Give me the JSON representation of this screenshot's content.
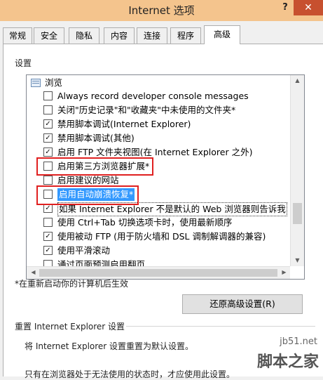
{
  "window": {
    "title": "Internet 选项",
    "help_label": "?",
    "close_label": "✕"
  },
  "tabs": [
    {
      "label": "常规"
    },
    {
      "label": "安全"
    },
    {
      "label": "隐私"
    },
    {
      "label": "内容"
    },
    {
      "label": "连接"
    },
    {
      "label": "程序"
    },
    {
      "label": "高级",
      "active": true
    }
  ],
  "settings": {
    "group_label": "设置",
    "category": "浏览",
    "items": [
      {
        "label": "Always record developer console messages",
        "checked": false
      },
      {
        "label": "关闭\"历史记录\"和\"收藏夹\"中未使用的文件夹*",
        "checked": false
      },
      {
        "label": "禁用脚本调试(Internet Explorer)",
        "checked": true
      },
      {
        "label": "禁用脚本调试(其他)",
        "checked": true
      },
      {
        "label": "启用 FTP 文件夹视图(在 Internet Explorer 之外)",
        "checked": true
      },
      {
        "label": "启用第三方浏览器扩展*",
        "checked": false
      },
      {
        "label": "启用建议的网站",
        "checked": false
      },
      {
        "label": "启用自动崩溃恢复*",
        "checked": false
      },
      {
        "label": "如果 Internet Explorer 不是默认的 Web 浏览器则告诉我",
        "checked": true
      },
      {
        "label": "使用 Ctrl+Tab 切换选项卡时，使用最新顺序",
        "checked": false
      },
      {
        "label": "使用被动 FTP (用于防火墙和 DSL 调制解调器的兼容)",
        "checked": true
      },
      {
        "label": "使用平滑滚动",
        "checked": true
      },
      {
        "label": "通过页面预测启用翻页",
        "checked": false
      }
    ],
    "restart_note": "*在重新启动你的计算机后生效",
    "restore_button": "还原高级设置(R)"
  },
  "reset": {
    "group_label": "重置 Internet Explorer 设置",
    "description": "将 Internet Explorer 设置重置为默认设置。",
    "note": "只有在浏览器处于无法使用的状态时，才应使用此设置。"
  },
  "watermark": {
    "url": "jb51.net",
    "name": "脚本之家"
  },
  "colors": {
    "titlebar": "#f4c48d",
    "close_button": "#c7502f",
    "selection": "#3399ff",
    "annotation_box": "#e02020"
  }
}
